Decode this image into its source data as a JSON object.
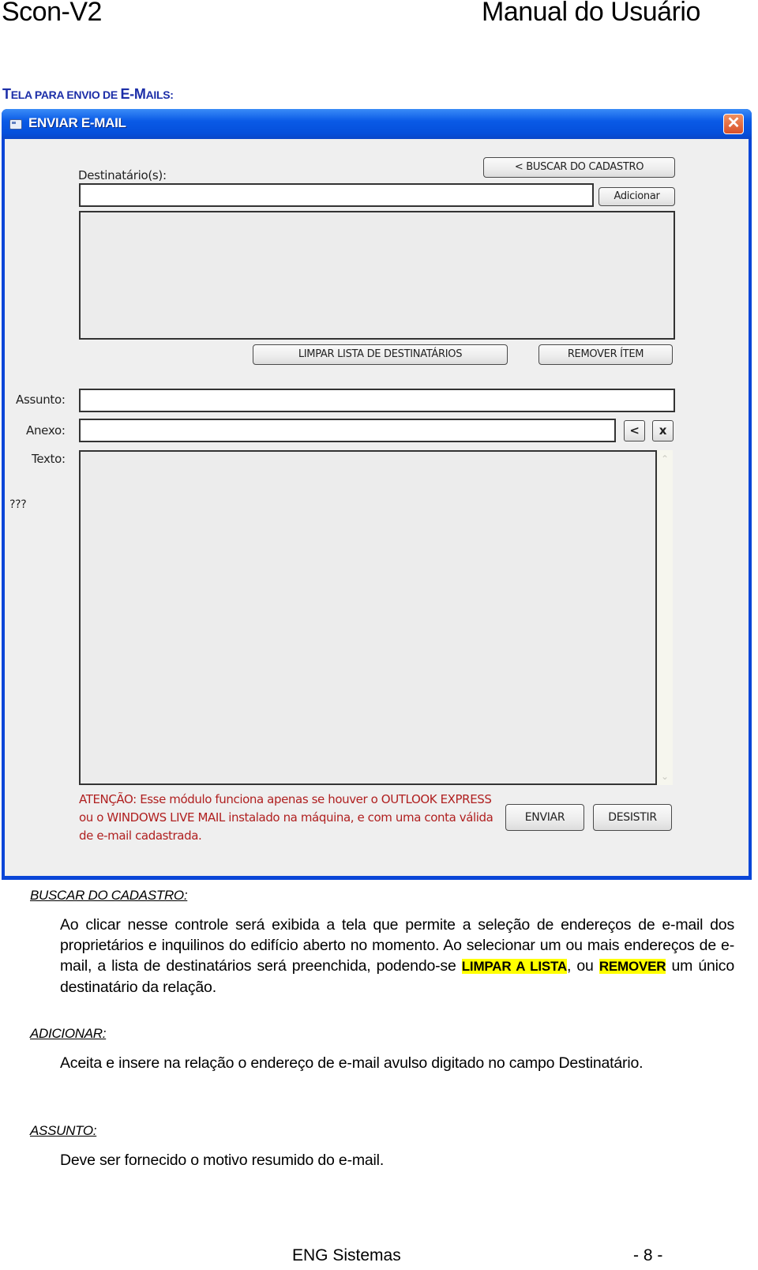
{
  "header": {
    "product": "Scon-V2",
    "doc_title": "Manual do Usuário"
  },
  "section_title": {
    "t1": "T",
    "t2": "ELA PARA ENVIO DE ",
    "t3": "E-M",
    "t4": "AILS:"
  },
  "window": {
    "title": "ENVIAR E-MAIL",
    "close_glyph": "✕",
    "fields": {
      "recipients_label": "Destinatário(s):",
      "recipients_value": "",
      "subject_label": "Assunto:",
      "subject_value": "",
      "attachment_label": "Anexo:",
      "attachment_value": "",
      "text_label": "Texto:",
      "text_value": "",
      "unknown_label": "???"
    },
    "buttons": {
      "search_registry": "< BUSCAR DO CADASTRO",
      "add": "Adicionar",
      "clear_list": "LIMPAR LISTA DE DESTINATÁRIOS",
      "remove_item": "REMOVER ÍTEM",
      "browse_attachment": "<",
      "clear_attachment": "x",
      "send": "ENVIAR",
      "cancel": "DESISTIR"
    },
    "scroll": {
      "up": "⌃",
      "down": "⌄"
    },
    "warning": "ATENÇÃO: Esse módulo funciona apenas se houver o OUTLOOK EXPRESS ou o WINDOWS LIVE MAIL instalado na máquina, e com uma conta válida de e-mail cadastrada."
  },
  "sections": [
    {
      "heading": "BUSCAR DO CADASTRO:",
      "text_a": "Ao clicar nesse controle será exibida a tela que permite a seleção de endereços de e-mail dos proprietários e inquilinos do edifício aberto no momento. Ao selecionar um ou mais endereços de e-mail, a lista de destinatários será preenchida, podendo-se ",
      "highlight_1": "LIMPAR A LISTA",
      "text_b": ", ou ",
      "highlight_2": "REMOVER",
      "text_c": " um único destinatário da relação."
    },
    {
      "heading": "ADICIONAR:",
      "text": "Aceita e insere na relação o endereço de e-mail avulso digitado no campo Destinatário."
    },
    {
      "heading": "ASSUNTO:",
      "text": "Deve ser fornecido o motivo resumido do e-mail."
    }
  ],
  "footer": {
    "company": "ENG Sistemas",
    "page": "- 8 -"
  }
}
